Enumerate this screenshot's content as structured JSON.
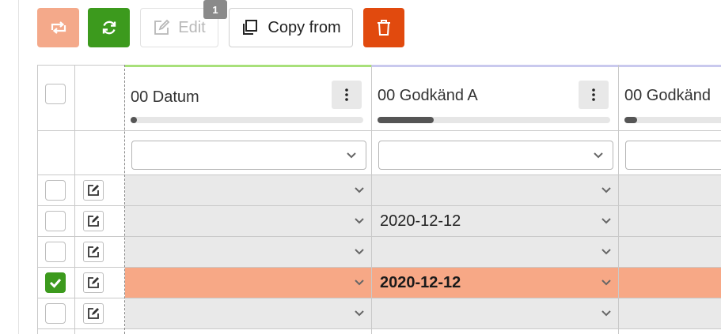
{
  "toolbar": {
    "edit_label": "Edit",
    "copy_label": "Copy from",
    "badge_count": "1",
    "colors": {
      "swap": "#f4a98a",
      "refresh": "#3c9a1d",
      "delete": "#e14a0e"
    },
    "icons": [
      "swap-icon",
      "refresh-icon",
      "edit-icon",
      "copy-icon",
      "trash-icon"
    ]
  },
  "grid": {
    "columns": [
      {
        "title": "00 Datum",
        "accent": "#a8e07a",
        "progress": 0.01
      },
      {
        "title": "00 Godkänd A",
        "accent": "#c9c9ee",
        "progress": 0.24
      },
      {
        "title": "00 Godkänd",
        "accent": "#c9c9ee",
        "progress": 0.12
      }
    ],
    "rows": [
      {
        "checked": false,
        "selected": false,
        "values": [
          "",
          "",
          ""
        ]
      },
      {
        "checked": false,
        "selected": false,
        "values": [
          "",
          "2020-12-12",
          ""
        ]
      },
      {
        "checked": false,
        "selected": false,
        "values": [
          "",
          "",
          ""
        ]
      },
      {
        "checked": true,
        "selected": true,
        "values": [
          "",
          "2020-12-12",
          ""
        ]
      },
      {
        "checked": false,
        "selected": false,
        "values": [
          "",
          "",
          ""
        ]
      }
    ],
    "selected_row_color": "#f7a886"
  }
}
